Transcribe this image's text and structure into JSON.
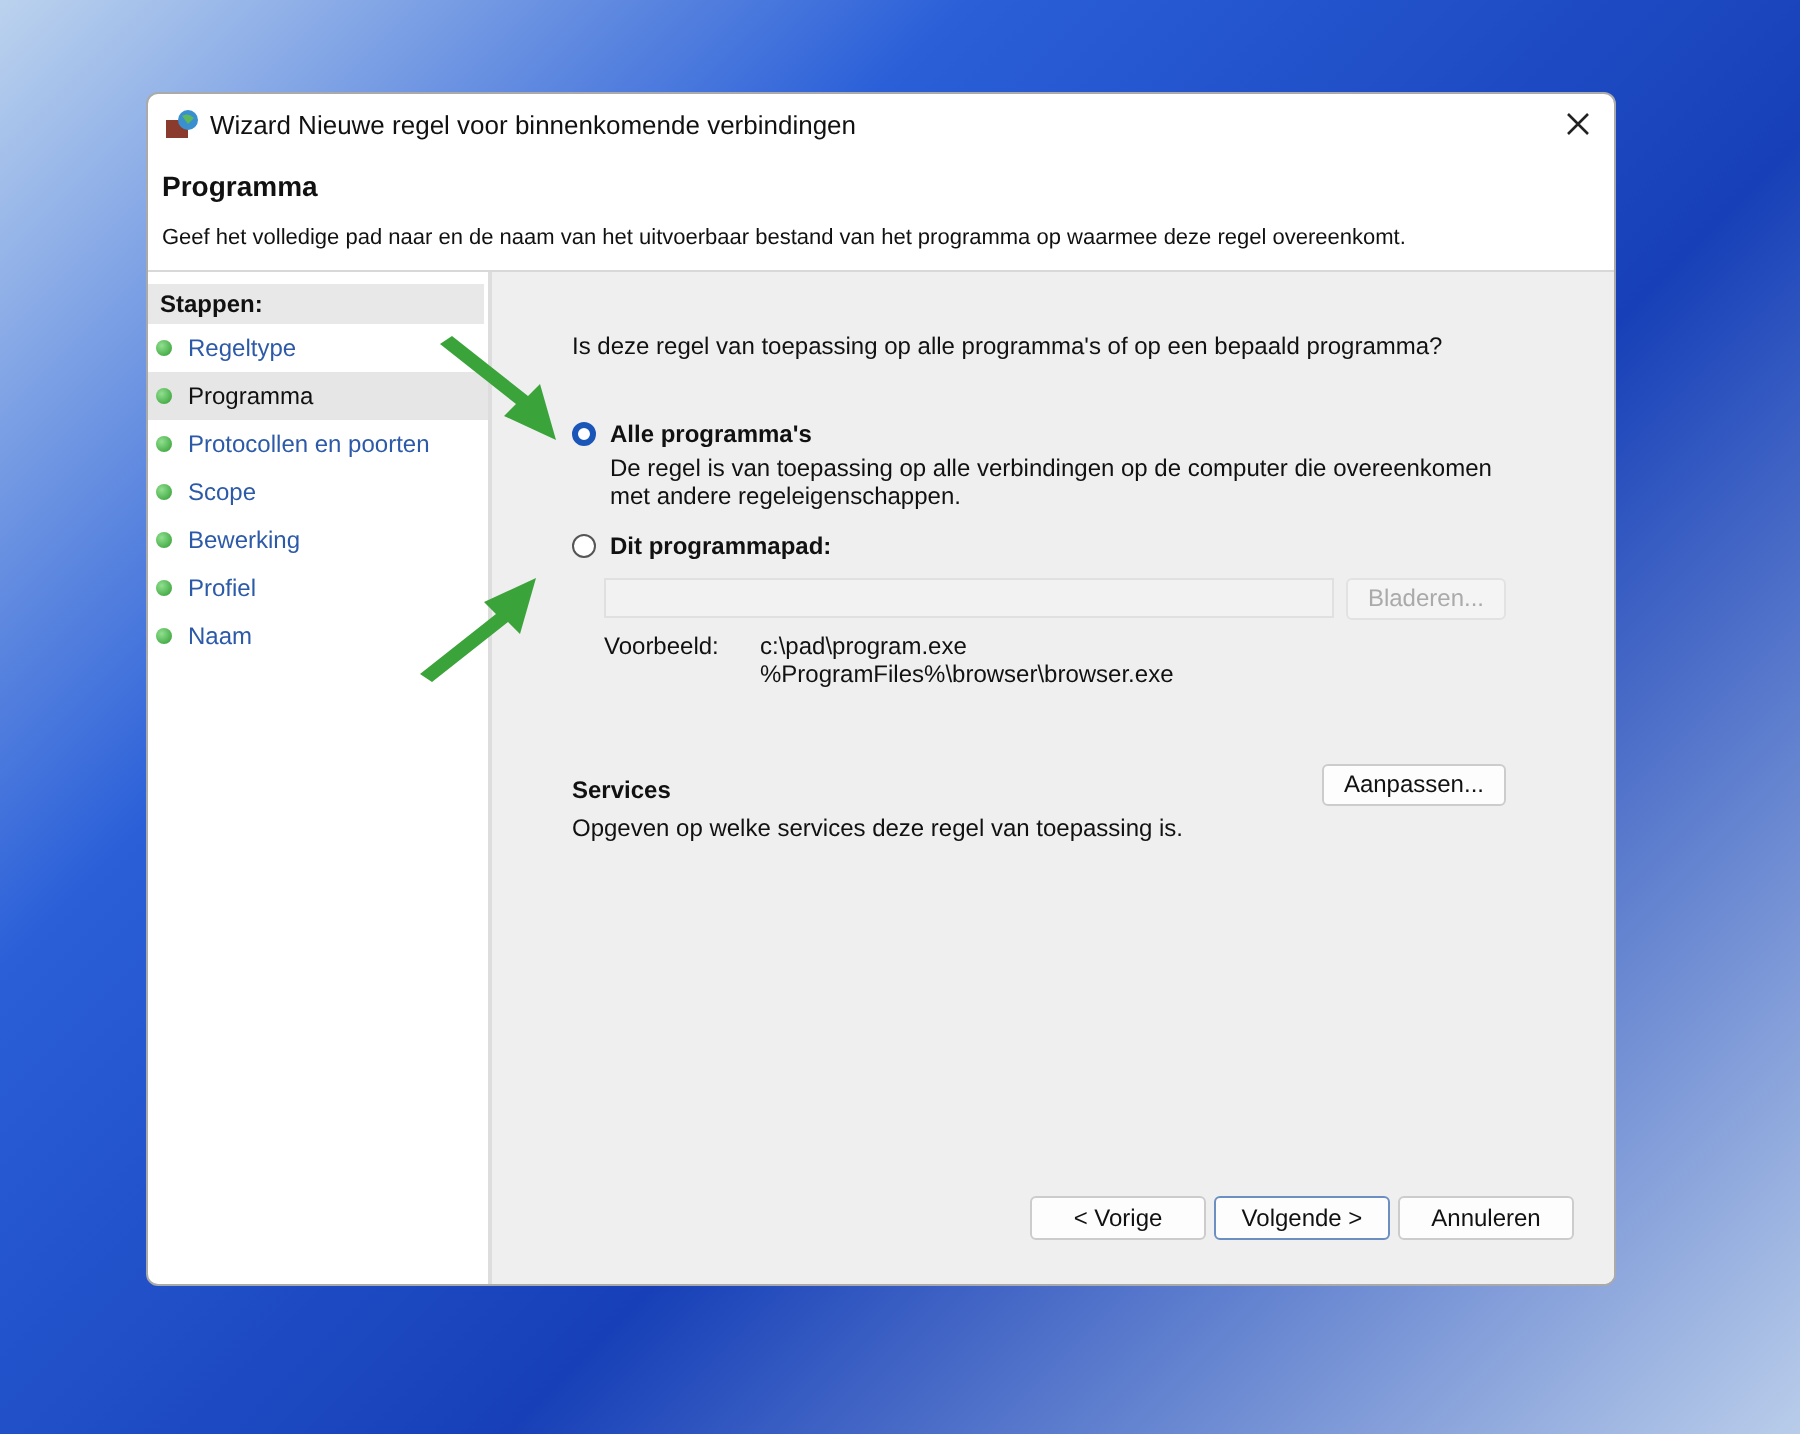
{
  "window": {
    "title": "Wizard Nieuwe regel voor binnenkomende verbindingen"
  },
  "header": {
    "title": "Programma",
    "description": "Geef het volledige pad naar en de naam van het uitvoerbaar bestand van het programma op waarmee deze regel overeenkomt."
  },
  "sidebar": {
    "title": "Stappen:",
    "items": [
      {
        "label": "Regeltype",
        "selected": false
      },
      {
        "label": "Programma",
        "selected": true
      },
      {
        "label": "Protocollen en poorten",
        "selected": false
      },
      {
        "label": "Scope",
        "selected": false
      },
      {
        "label": "Bewerking",
        "selected": false
      },
      {
        "label": "Profiel",
        "selected": false
      },
      {
        "label": "Naam",
        "selected": false
      }
    ]
  },
  "question": "Is deze regel van toepassing op alle programma's of op een bepaald programma?",
  "options": [
    {
      "label": "Alle programma's",
      "description": "De regel is van toepassing op alle verbindingen op de computer die overeenkomen met andere regeleigenschappen.",
      "selected": true
    },
    {
      "label": "Dit programmapad:",
      "selected": false
    }
  ],
  "path": {
    "disabled": true,
    "browse_button": "Bladeren...",
    "example_label": "Voorbeeld:",
    "examples": [
      "c:\\pad\\program.exe",
      "%ProgramFiles%\\browser\\browser.exe"
    ]
  },
  "services": {
    "title": "Services",
    "description": "Opgeven op welke services deze regel van toepassing is.",
    "button": "Aanpassen..."
  },
  "buttons": [
    {
      "label": "< Vorige",
      "selected": false
    },
    {
      "label": "Volgende >",
      "selected": true
    },
    {
      "label": "Annuleren",
      "selected": false
    }
  ]
}
